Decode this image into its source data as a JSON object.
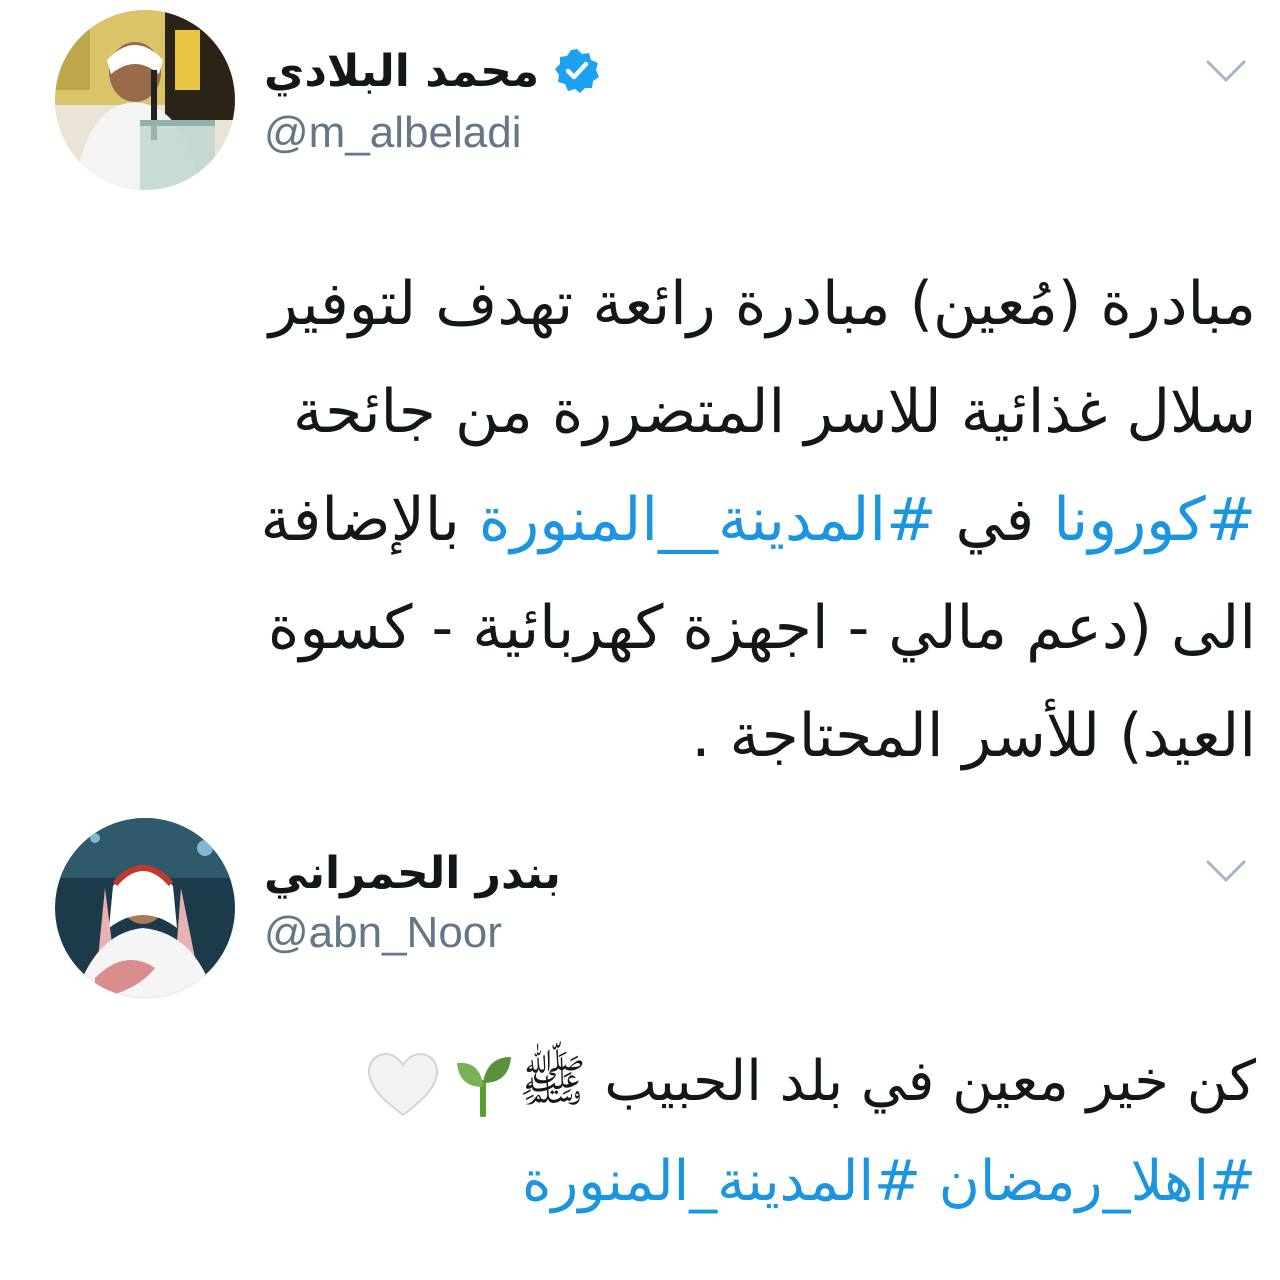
{
  "colors": {
    "text": "#14171a",
    "secondary": "#657786",
    "link": "#1b95e0",
    "verified": "#1da1f2",
    "background": "#ffffff"
  },
  "tweets": [
    {
      "display_name": "محمد البلادي",
      "handle": "@m_albeladi",
      "verified": true,
      "menu_icon": "chevron-down-icon",
      "body": {
        "line1": "مبادرة (مُعين) مبادرة رائعة تهدف لتوفير",
        "line2": "سلال غذائية للاسر المتضررة من جائحة",
        "line3": {
          "hashtag1": "#كورونا",
          "word": "في",
          "hashtag2": "#المدينة__المنورة",
          "tail": "بالإضافة"
        },
        "line4": "الى  (دعم مالي - اجهزة كهربائية - كسوة",
        "line5": "العيد) للأسر المحتاجة ."
      }
    },
    {
      "display_name": "بندر الحمراني",
      "handle": "@abn_Noor",
      "verified": false,
      "menu_icon": "chevron-down-icon",
      "body": {
        "line1": "كن خير معين في بلد الحبيب ﷺ",
        "emoji_1": "seedling-emoji",
        "emoji_2": "white-heart-emoji",
        "hashtag1": "#اهلا_رمضان",
        "hashtag2": "#المدينة_المنورة"
      }
    }
  ]
}
